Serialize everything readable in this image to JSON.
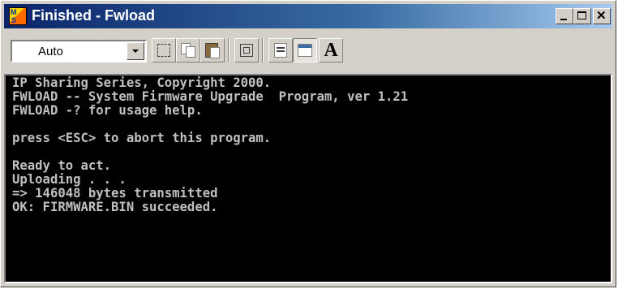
{
  "window": {
    "title": "Finished - Fwload",
    "icon": "ms-dos-icon",
    "icon_letters": [
      "M",
      "S"
    ]
  },
  "title_buttons": [
    {
      "name": "minimize-icon"
    },
    {
      "name": "maximize-icon"
    },
    {
      "name": "close-icon"
    }
  ],
  "toolbar": {
    "font_size_value": "Auto",
    "buttons": [
      {
        "name": "mark-icon"
      },
      {
        "name": "copy-icon"
      },
      {
        "name": "paste-icon"
      },
      {
        "name": "full-screen-icon"
      },
      {
        "name": "properties-icon"
      },
      {
        "name": "background-icon"
      },
      {
        "name": "font-icon",
        "label": "A"
      }
    ]
  },
  "console": {
    "text_color": "#c0c0c0",
    "background": "#000000",
    "lines": [
      "IP Sharing Series, Copyright 2000.",
      "FWLOAD -- System Firmware Upgrade  Program, ver 1.21",
      "FWLOAD -? for usage help.",
      "",
      "press <ESC> to abort this program.",
      "",
      "Ready to act.",
      "Uploading . . .",
      "=> 146048 bytes transmitted",
      "OK: FIRMWARE.BIN succeeded."
    ]
  }
}
